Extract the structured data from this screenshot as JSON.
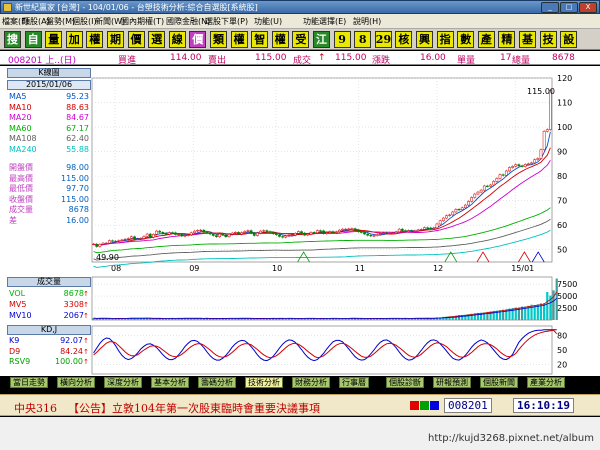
{
  "window": {
    "title": "新世紀贏家 [台灣] - 104/01/06 - 台塑技術分析:綜合自選股[系統股]",
    "min_label": "_",
    "max_label": "□",
    "close_label": "X"
  },
  "menu": {
    "items": [
      "檔案(F)",
      "類股(A)",
      "盤勢(M)",
      "個股(I)",
      "新聞(W)",
      "國內期權(T)",
      "國際金融(N)",
      "選股下單(P)",
      "功能(U)",
      "功能選擇(E)",
      "說明(H)"
    ]
  },
  "toolbar": {
    "buttons": [
      "搜",
      "自",
      "量",
      "加",
      "權",
      "期",
      "價",
      "選",
      "線",
      "價",
      "類",
      "權",
      "智",
      "權",
      "受",
      "江",
      "9",
      "8",
      "29",
      "核",
      "興",
      "指",
      "數",
      "產",
      "精",
      "基",
      "技",
      "設"
    ],
    "button_colors": [
      "#2a8a2a",
      "#2a8a2a",
      "#e8e800",
      "#e8e800",
      "#e8e800",
      "#e8e800",
      "#e8e800",
      "#e8e800",
      "#e8e800",
      "#c040c0",
      "#e8e800",
      "#e8e800",
      "#e8e800",
      "#e8e800",
      "#e8e800",
      "#2a8a2a",
      "#e8e800",
      "#e8e800",
      "#e8e800",
      "#e8e800",
      "#e8e800",
      "#e8e800",
      "#e8e800",
      "#e8e800",
      "#e8e800",
      "#e8e800",
      "#e8e800",
      "#e8e800"
    ]
  },
  "quote": {
    "code": "008201 上..(日)",
    "buy_label": "買進",
    "buy": "114.00",
    "sell_label": "賣出",
    "sell": "115.00",
    "trade_label": "成交",
    "trade": "115.00",
    "change_label": "漲跌",
    "change": "16.00",
    "unit_label": "單量",
    "unit_vol": "17",
    "total_label": "總量",
    "total_vol": "8678"
  },
  "info": {
    "kline_title": "K線圖",
    "date": "2015/01/06",
    "ma": [
      {
        "label": "MA5",
        "value": "95.23",
        "color": "#0050d0"
      },
      {
        "label": "MA10",
        "value": "88.63",
        "color": "#d00000"
      },
      {
        "label": "MA20",
        "value": "84.67",
        "color": "#d000d0"
      },
      {
        "label": "MA60",
        "value": "67.17",
        "color": "#00b000"
      },
      {
        "label": "MA108",
        "value": "62.40",
        "color": "#606060"
      },
      {
        "label": "MA240",
        "value": "55.88",
        "color": "#00c0c0"
      }
    ],
    "prices": [
      {
        "label": "開盤價",
        "value": "98.00"
      },
      {
        "label": "最高價",
        "value": "115.00"
      },
      {
        "label": "最低價",
        "value": "97.70"
      },
      {
        "label": "收盤價",
        "value": "115.00"
      },
      {
        "label": "成交量",
        "value": "8678"
      },
      {
        "label": "差",
        "value": "16.00"
      }
    ],
    "vol_title": "成交量",
    "vol": [
      {
        "label": "VOL",
        "value": "8678",
        "color": "#00b000"
      },
      {
        "label": "MV5",
        "value": "3308",
        "color": "#d00000"
      },
      {
        "label": "MV10",
        "value": "2067",
        "color": "#0000d0"
      }
    ],
    "kdj_title": "KD,J",
    "kdj": [
      {
        "label": "K9",
        "value": "92.07",
        "color": "#0000d0"
      },
      {
        "label": "D9",
        "value": "84.24",
        "color": "#d00000"
      },
      {
        "label": "RSV9",
        "value": "100.00",
        "color": "#00a000"
      }
    ]
  },
  "chart_data": [
    {
      "type": "candlestick",
      "price_top_label": "115.00",
      "low_label": "49.90",
      "ylim": [
        45,
        120
      ],
      "yticks": [
        50,
        60,
        70,
        80,
        90,
        100,
        110,
        120
      ],
      "xticks": [
        "08",
        "09",
        "10",
        "11",
        "12",
        "15/01"
      ],
      "close": [
        52.3,
        51.3,
        52.2,
        52.7,
        52.7,
        53.7,
        53.5,
        53.4,
        53.7,
        54.0,
        54.3,
        54.6,
        55.3,
        54.3,
        54.4,
        54.6,
        55.5,
        56.4,
        55.1,
        56.3,
        57.6,
        57.1,
        56.6,
        56.3,
        57.0,
        56.9,
        56.2,
        56.3,
        55.6,
        55.8,
        56.1,
        56.9,
        57.6,
        57.9,
        58.0,
        57.2,
        56.8,
        56.4,
        55.8,
        55.3,
        56.4,
        56.1,
        55.3,
        56.3,
        56.8,
        57.1,
        56.4,
        57.0,
        57.5,
        57.8,
        56.8,
        55.8,
        56.8,
        57.6,
        57.8,
        57.4,
        57.0,
        56.5,
        56.1,
        55.4,
        55.1,
        55.6,
        55.9,
        56.0,
        56.7,
        57.4,
        56.8,
        56.0,
        56.4,
        57.1,
        56.9,
        57.8,
        57.7,
        56.6,
        57.0,
        57.4,
        57.0,
        57.3,
        58.0,
        58.4,
        58.4,
        58.5,
        58.6,
        58.0,
        57.3,
        57.1,
        56.4,
        55.9,
        55.6,
        55.8,
        56.2,
        56.6,
        56.9,
        56.8,
        56.8,
        56.9,
        57.3,
        58.4,
        57.8,
        57.4,
        57.8,
        57.5,
        57.7,
        58.1,
        58.3,
        59.0,
        58.9,
        58.6,
        58.9,
        60.5,
        61.8,
        62.9,
        63.9,
        64.2,
        65.4,
        66.5,
        66.3,
        67.1,
        68.2,
        69.7,
        71.3,
        72.7,
        73.5,
        74.3,
        76.0,
        75.9,
        76.4,
        77.9,
        79.1,
        80.6,
        80.3,
        82.1,
        83.5,
        84.0,
        84.7,
        84.2,
        83.9,
        84.8,
        85.0,
        85.4,
        86.7,
        87.2,
        90.8,
        98.3,
        99.0,
        115.0
      ],
      "ma_series": [
        "MA5",
        "MA10",
        "MA20",
        "MA60",
        "MA108",
        "MA240"
      ]
    },
    {
      "type": "bar",
      "name": "成交量",
      "yticks": [
        2500,
        5000,
        7500
      ],
      "ylim": [
        0,
        9000
      ],
      "values": [
        386,
        302,
        353,
        410,
        288,
        349,
        256,
        278,
        308,
        372,
        408,
        404,
        400,
        397,
        417,
        336,
        342,
        379,
        277,
        302,
        274,
        405,
        276,
        398,
        309,
        413,
        262,
        417,
        367,
        342,
        409,
        279,
        386,
        371,
        282,
        308,
        396,
        260,
        258,
        352,
        327,
        310,
        354,
        411,
        348,
        375,
        325,
        375,
        349,
        324,
        287,
        280,
        254,
        375,
        315,
        342,
        381,
        365,
        260,
        404,
        373,
        272,
        388,
        311,
        307,
        325,
        300,
        401,
        386,
        326,
        335,
        259,
        268,
        374,
        399,
        361,
        344,
        254,
        345,
        352,
        338,
        376,
        417,
        279,
        325,
        347,
        325,
        267,
        302,
        340,
        372,
        302,
        330,
        378,
        365,
        382,
        376,
        267,
        292,
        402,
        340,
        265,
        398,
        386,
        386,
        367,
        359,
        312,
        366,
        547,
        554,
        660,
        703,
        776,
        817,
        926,
        1034,
        1067,
        1111,
        1218,
        1320,
        1408,
        1484,
        1520,
        1578,
        1697,
        1812,
        1914,
        1972,
        2067,
        2167,
        2266,
        2392,
        2508,
        2629,
        2626,
        2817,
        2830,
        2976,
        3203,
        3137,
        3293,
        3494,
        3554,
        5860,
        5120,
        6200,
        8678
      ]
    },
    {
      "type": "line",
      "name": "KD,J",
      "yticks": [
        20,
        50,
        80
      ],
      "ylim": [
        0,
        100
      ],
      "series": [
        {
          "name": "K9",
          "values": [
            44,
            54,
            64,
            71,
            75,
            74,
            68,
            59,
            48,
            39,
            33,
            30,
            32,
            37,
            44,
            52,
            58,
            62,
            63,
            60,
            55,
            48,
            40,
            34,
            30,
            30,
            33,
            40,
            48,
            57,
            64,
            69,
            70,
            68,
            62,
            55,
            46,
            38,
            32,
            29,
            29,
            33,
            39,
            47,
            56,
            63,
            68,
            70,
            69,
            64,
            57,
            49,
            40,
            33,
            29,
            28,
            31,
            37,
            45,
            54,
            62,
            68,
            71,
            70,
            66,
            59,
            51,
            42,
            35,
            30,
            28,
            30,
            36,
            43,
            52,
            60,
            67,
            70,
            70,
            67,
            60,
            52,
            44,
            36,
            31,
            29,
            30,
            35,
            42,
            50,
            59,
            66,
            70,
            71,
            68,
            62,
            55,
            46,
            38,
            32,
            29,
            30,
            34,
            41,
            49,
            58,
            65,
            70,
            71,
            69,
            63,
            56,
            48,
            40,
            33,
            30,
            29,
            33,
            39,
            47,
            56,
            63,
            68,
            71,
            69,
            65,
            58,
            50,
            42,
            35,
            31,
            30,
            34,
            41,
            54,
            66,
            74,
            80,
            85,
            88,
            90,
            91,
            91,
            92,
            92,
            92,
            92,
            92
          ]
        },
        {
          "name": "D9",
          "values": [
            40,
            45,
            52,
            58,
            64,
            67,
            67,
            65,
            59,
            53,
            46,
            41,
            38,
            38,
            40,
            45,
            50,
            54,
            58,
            59,
            58,
            55,
            50,
            45,
            40,
            37,
            36,
            37,
            41,
            46,
            52,
            57,
            61,
            63,
            63,
            60,
            55,
            50,
            44,
            39,
            36,
            35,
            36,
            40,
            45,
            51,
            57,
            61,
            63,
            63,
            61,
            56,
            51,
            45,
            40,
            36,
            34,
            35,
            38,
            43,
            49,
            55,
            60,
            63,
            64,
            62,
            58,
            53,
            47,
            42,
            37,
            34,
            35,
            38,
            43,
            49,
            55,
            60,
            63,
            64,
            62,
            58,
            53,
            47,
            42,
            37,
            35,
            35,
            37,
            42,
            48,
            54,
            59,
            63,
            64,
            63,
            60,
            55,
            50,
            44,
            39,
            36,
            35,
            37,
            41,
            47,
            53,
            59,
            63,
            65,
            64,
            61,
            57,
            51,
            45,
            40,
            36,
            35,
            36,
            40,
            45,
            51,
            57,
            61,
            63,
            63,
            61,
            57,
            52,
            46,
            41,
            37,
            36,
            38,
            43,
            51,
            59,
            66,
            72,
            77,
            81,
            84,
            86,
            88,
            89,
            90,
            91,
            84
          ]
        }
      ]
    }
  ],
  "tabs": [
    "當日走勢",
    "橫向分析",
    "深度分析",
    "基本分析",
    "籌碼分析",
    "技術分析",
    "財務分析",
    "行事曆",
    "個股診斷",
    "研報預測",
    "個股新聞",
    "產業分析"
  ],
  "news": {
    "source": "中央316",
    "text": "【公告】立敦104年第一次股東臨時會重要決議事項",
    "code": "008201",
    "time": "16:10:19"
  },
  "watermark": "http://kujd3268.pixnet.net/album"
}
